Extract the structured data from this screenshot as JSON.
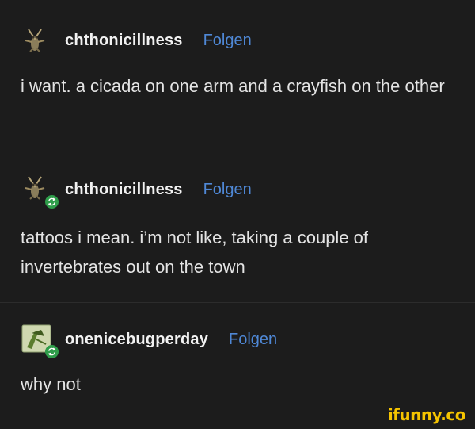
{
  "posts": [
    {
      "username": "chthonicillness",
      "follow_label": "Folgen",
      "text": "i want. a cicada on one arm and a crayfish on the other",
      "reblog": false
    },
    {
      "username": "chthonicillness",
      "follow_label": "Folgen",
      "text": "tattoos i mean. i’m not like, taking a couple of invertebrates out on the town",
      "reblog": true
    },
    {
      "username": "onenicebugperday",
      "follow_label": "Folgen",
      "text": "why not",
      "reblog": true
    }
  ],
  "watermark": "ifunny.co",
  "colors": {
    "background": "#1c1c1c",
    "follow_link": "#4f88d6",
    "reblog_badge": "#2f9d4a",
    "watermark": "#f5c400"
  }
}
